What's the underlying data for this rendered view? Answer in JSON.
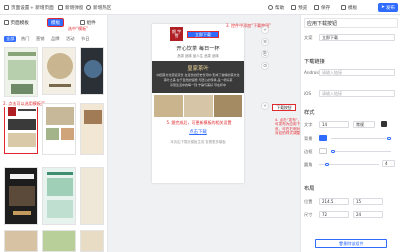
{
  "toolbar": {
    "page_setting": "页面设置",
    "add_page": "+ 新增页面",
    "add_popup": "新增弹窗",
    "add_hotspot": "新增热区",
    "help": "帮助",
    "preview": "预览",
    "save": "保存",
    "template": "模板",
    "publish": "发布"
  },
  "left": {
    "tab_page_template": "页面模板",
    "tab_template": "模板",
    "tab_component": "组件",
    "categories": [
      "全部",
      "热门",
      "营销",
      "品牌",
      "活动",
      "节日"
    ],
    "annotation_template": "选中“模板”",
    "annotation_click": "2. 点击可以选用模板页"
  },
  "canvas": {
    "title_brush": "朗 宇 雪",
    "download_btn": "立即下载",
    "annotation_1": "3. 控件中添加“下载按钮”",
    "phone_heading": "开心饮茶 每日一杯",
    "phone_subtitle": "品茶 品味 品人生 品茶 品味",
    "banner_title": "皇家茶叶",
    "banner_text_1": "中国茶文化源远流长 在漫长的历史长河中 形成了独特的茶文化",
    "banner_text_2": "茶叶之美 在于自然的馈赠 与匠心的传承 品一杯好茶",
    "banner_text_3": "享受生活中的每一刻 宁静与美好 尽在杯中",
    "annotation_5": "5. 跟完成后，可更新模板的相关设置",
    "link_text": "点击下载",
    "footer_text": "本页由下载页模板生成 查看更多模板",
    "download_btn_2": "下载按钮",
    "annotation_4": "4. 点击“发布”，即可发布为应用下载页，可在右侧对各对应的样式调整",
    "side_buttons": [
      "+",
      "≡",
      "⎘",
      "⊙",
      "+"
    ]
  },
  "right": {
    "section_app": "应用下载按钮",
    "text_label": "文案",
    "text_value": "立即下载",
    "section_link": "下载链接",
    "android_label": "Android",
    "android_placeholder": "请输入链接",
    "ios_label": "iOS",
    "ios_placeholder": "请输入链接",
    "section_style": "样式",
    "font_label": "文字",
    "font_size": "14",
    "font_weight": "常规",
    "bg_label": "背景",
    "border_label": "边框",
    "radius_label": "圆角",
    "radius_value": "4",
    "section_layout": "布局",
    "pos_label": "位置",
    "pos_x": "214.5",
    "pos_y": "15",
    "size_label": "尺寸",
    "size_w": "72",
    "size_h": "24",
    "delete_btn": "删除该组件",
    "opacity_value": "100",
    "colors": {
      "primary": "#2f6bff",
      "annotation": "#e0282e",
      "dark_banner": "#3a3a3a"
    }
  }
}
